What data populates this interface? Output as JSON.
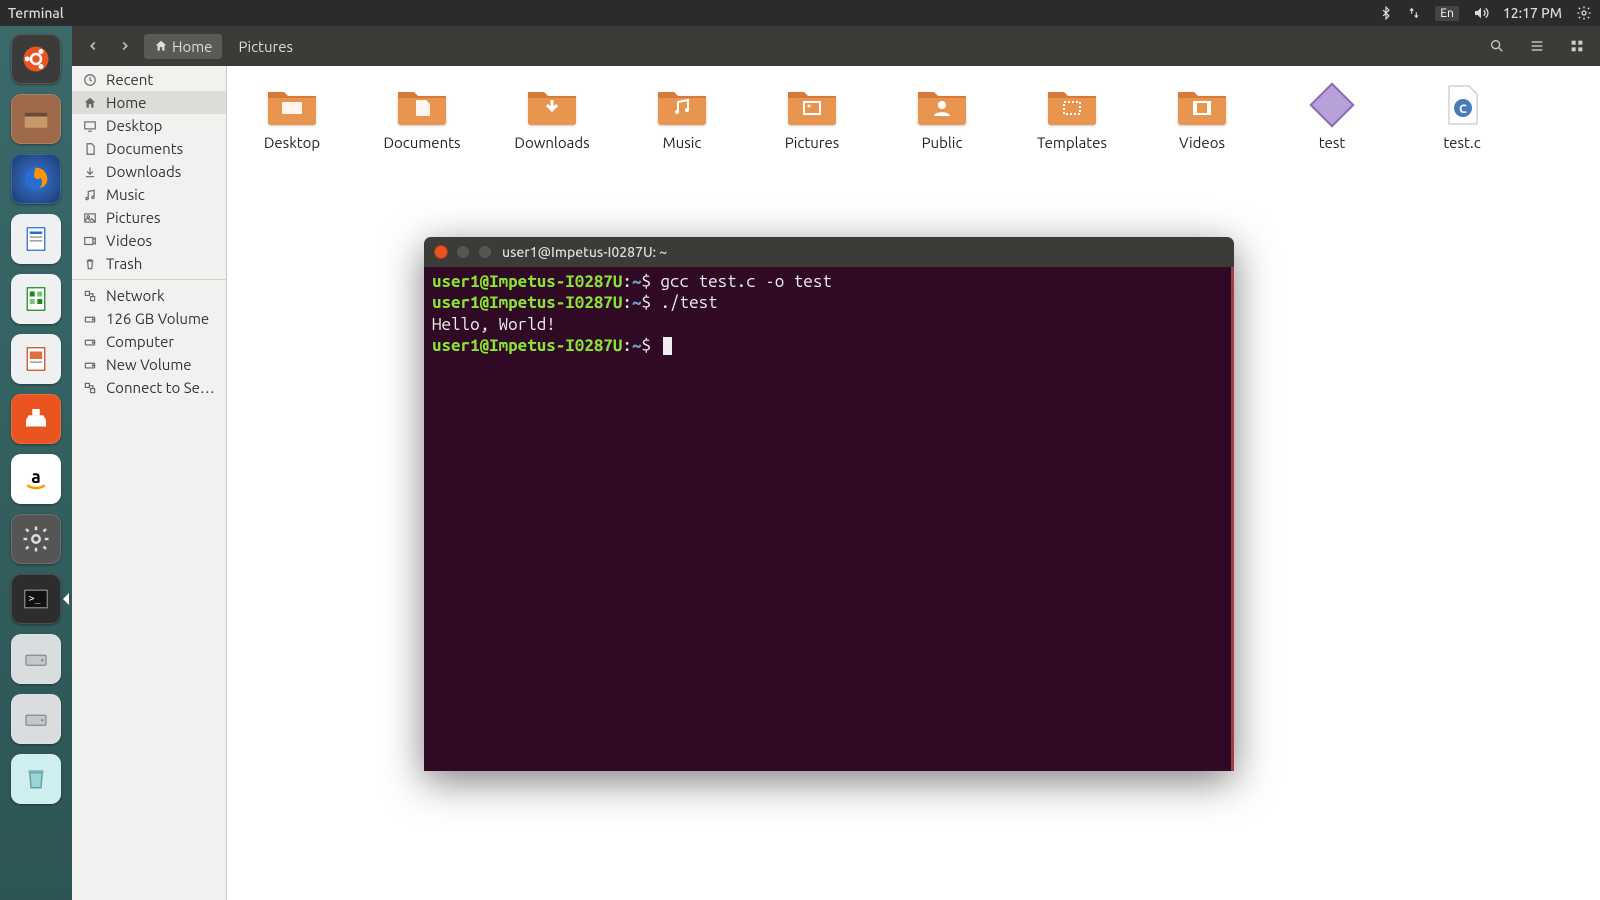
{
  "topbar": {
    "app_title": "Terminal",
    "language": "En",
    "clock": "12:17 PM"
  },
  "launcher": {
    "items": [
      {
        "name": "ubuntu-dash"
      },
      {
        "name": "files"
      },
      {
        "name": "firefox"
      },
      {
        "name": "libreoffice-writer"
      },
      {
        "name": "libreoffice-calc"
      },
      {
        "name": "libreoffice-impress"
      },
      {
        "name": "ubuntu-software"
      },
      {
        "name": "amazon"
      },
      {
        "name": "system-settings"
      },
      {
        "name": "terminal"
      },
      {
        "name": "disk-1"
      },
      {
        "name": "disk-2"
      },
      {
        "name": "trash"
      }
    ]
  },
  "file_manager": {
    "breadcrumbs": [
      {
        "label": "Home",
        "home": true
      },
      {
        "label": "Pictures",
        "home": false
      }
    ],
    "sidebar": {
      "places": [
        {
          "label": "Recent",
          "icon": "clock"
        },
        {
          "label": "Home",
          "icon": "home",
          "selected": true
        },
        {
          "label": "Desktop",
          "icon": "desktop"
        },
        {
          "label": "Documents",
          "icon": "doc"
        },
        {
          "label": "Downloads",
          "icon": "down"
        },
        {
          "label": "Music",
          "icon": "music"
        },
        {
          "label": "Pictures",
          "icon": "pic"
        },
        {
          "label": "Videos",
          "icon": "vid"
        },
        {
          "label": "Trash",
          "icon": "trash"
        }
      ],
      "devices": [
        {
          "label": "Network",
          "icon": "net"
        },
        {
          "label": "126 GB Volume",
          "icon": "disk"
        },
        {
          "label": "Computer",
          "icon": "disk"
        },
        {
          "label": "New Volume",
          "icon": "disk"
        },
        {
          "label": "Connect to Se…",
          "icon": "net"
        }
      ]
    },
    "files": [
      {
        "label": "Desktop",
        "type": "folder",
        "emblem": "desktop"
      },
      {
        "label": "Documents",
        "type": "folder",
        "emblem": "doc"
      },
      {
        "label": "Downloads",
        "type": "folder",
        "emblem": "down"
      },
      {
        "label": "Music",
        "type": "folder",
        "emblem": "music"
      },
      {
        "label": "Pictures",
        "type": "folder",
        "emblem": "pic"
      },
      {
        "label": "Public",
        "type": "folder",
        "emblem": "public"
      },
      {
        "label": "Templates",
        "type": "folder",
        "emblem": "template"
      },
      {
        "label": "Videos",
        "type": "folder",
        "emblem": "vid"
      },
      {
        "label": "test",
        "type": "exec"
      },
      {
        "label": "test.c",
        "type": "csrc"
      }
    ]
  },
  "terminal": {
    "window_title": "user1@Impetus-I0287U: ~",
    "prompt_user": "user1@Impetus-I0287U",
    "prompt_path": "~",
    "lines": [
      {
        "cmd": "gcc test.c -o test"
      },
      {
        "cmd": "./test"
      },
      {
        "out": "Hello, World!"
      }
    ]
  }
}
